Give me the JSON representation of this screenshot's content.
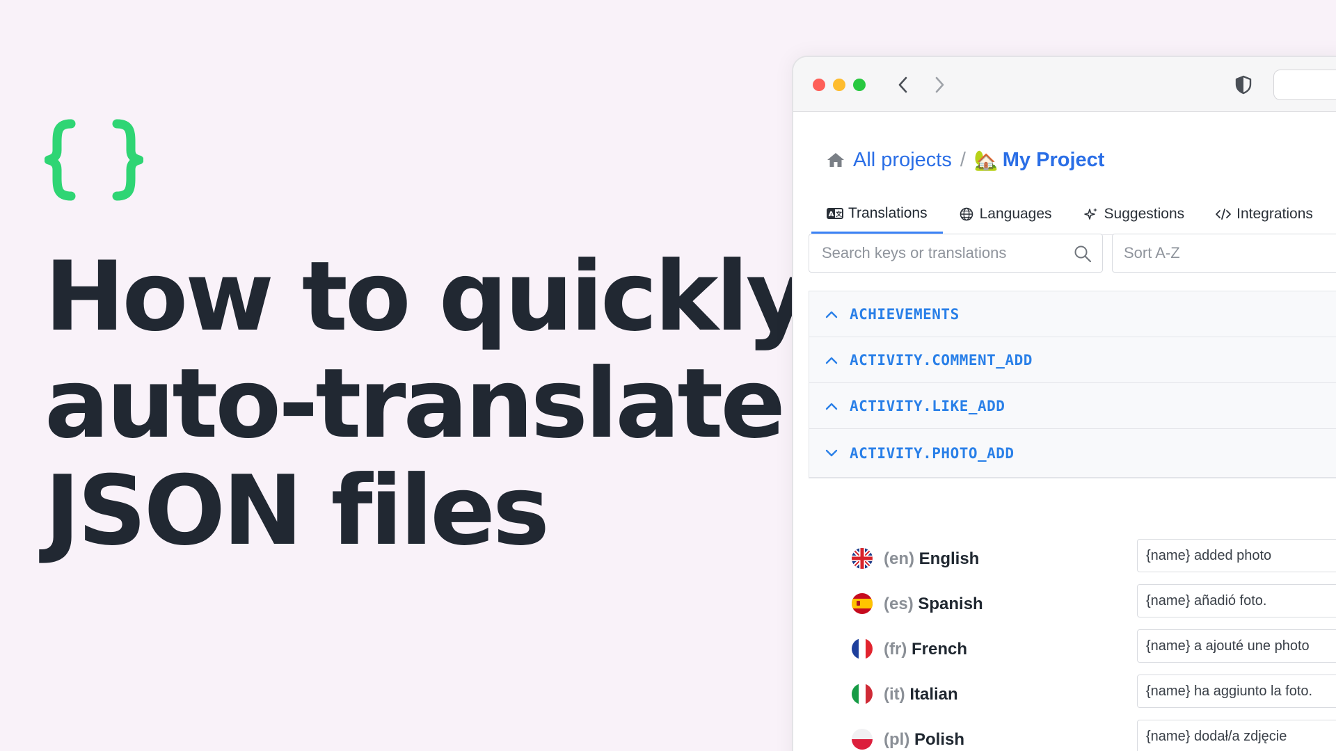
{
  "headline": {
    "lines": [
      "How to quickly",
      "auto-translate",
      "JSON files"
    ]
  },
  "colors": {
    "brand_green": "#2fd574",
    "link_blue": "#2a6ee6",
    "key_blue": "#2a80e8",
    "background": "#f9f2f9"
  },
  "browser": {
    "breadcrumb": {
      "home_icon": "home-icon",
      "all_projects": "All projects",
      "separator": "/",
      "project_emoji": "🏡",
      "project_name": "My Project"
    },
    "tabs": [
      {
        "label": "Translations",
        "icon": "translate-icon",
        "active": true
      },
      {
        "label": "Languages",
        "icon": "globe-icon",
        "active": false
      },
      {
        "label": "Suggestions",
        "icon": "sparkle-icon",
        "active": false
      },
      {
        "label": "Integrations",
        "icon": "code-icon",
        "active": false
      }
    ],
    "search": {
      "placeholder": "Search keys or translations"
    },
    "sort": {
      "value": "Sort A-Z"
    },
    "keys": [
      {
        "name": "ACHIEVEMENTS",
        "expanded": false
      },
      {
        "name": "ACTIVITY.COMMENT_ADD",
        "expanded": false
      },
      {
        "name": "ACTIVITY.LIKE_ADD",
        "expanded": false
      },
      {
        "name": "ACTIVITY.PHOTO_ADD",
        "expanded": true
      }
    ],
    "translations": [
      {
        "code": "(en)",
        "language": "English",
        "value": "{name} added photo",
        "flag": "uk-flag-icon"
      },
      {
        "code": "(es)",
        "language": "Spanish",
        "value": "{name} añadió foto.",
        "flag": "spain-flag-icon"
      },
      {
        "code": "(fr)",
        "language": "French",
        "value": "{name} a ajouté une photo",
        "flag": "france-flag-icon"
      },
      {
        "code": "(it)",
        "language": "Italian",
        "value": "{name} ha aggiunto la foto.",
        "flag": "italy-flag-icon"
      },
      {
        "code": "(pl)",
        "language": "Polish",
        "value": "{name} dodał/a zdjęcie",
        "flag": "poland-flag-icon"
      }
    ]
  }
}
